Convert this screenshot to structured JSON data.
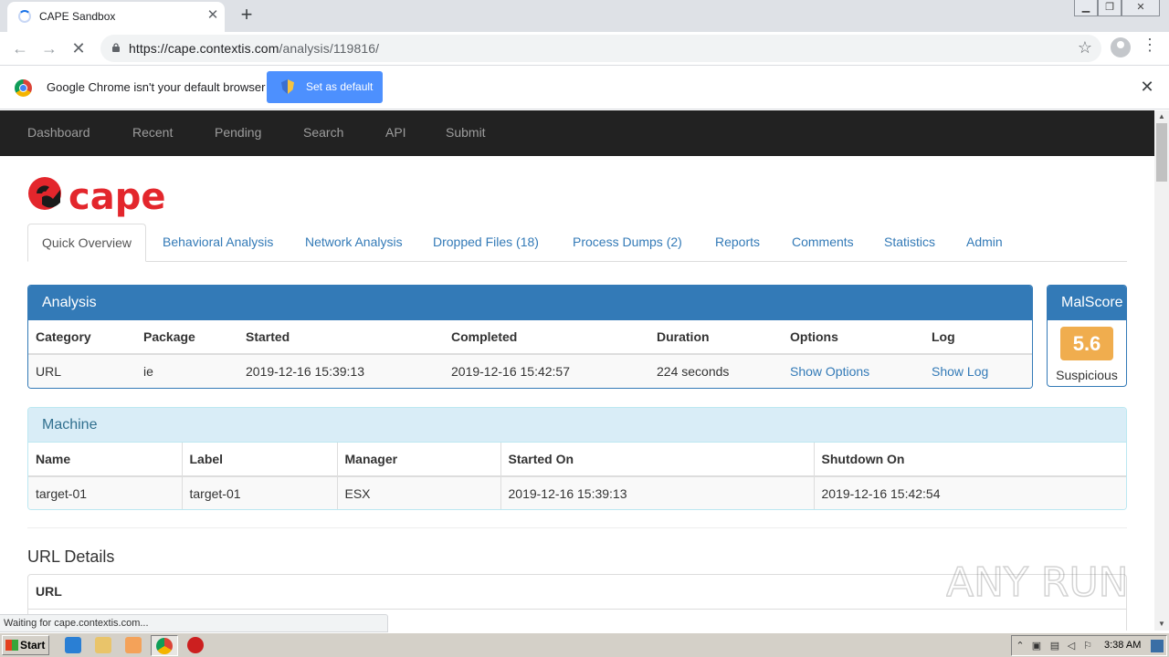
{
  "browser": {
    "tab_title": "CAPE Sandbox",
    "tab_close": "✕",
    "new_tab": "+",
    "url_host": "https://cape.contextis.com",
    "url_path": "/analysis/119816/",
    "infobar_text": "Google Chrome isn't your default browser",
    "infobar_button": "Set as default",
    "infobar_close": "✕",
    "status_text": "Waiting for cape.contextis.com..."
  },
  "navbar": {
    "items": [
      "Dashboard",
      "Recent",
      "Pending",
      "Search",
      "API",
      "Submit"
    ]
  },
  "logo_text": "cape",
  "tabs": {
    "quick_overview": "Quick Overview",
    "behavioral": "Behavioral Analysis",
    "network": "Network Analysis",
    "dropped": "Dropped Files (18)",
    "process_dumps": "Process Dumps (2)",
    "reports": "Reports",
    "comments": "Comments",
    "statistics": "Statistics",
    "admin": "Admin"
  },
  "analysis": {
    "title": "Analysis",
    "headers": {
      "category": "Category",
      "package": "Package",
      "started": "Started",
      "completed": "Completed",
      "duration": "Duration",
      "options": "Options",
      "log": "Log"
    },
    "row": {
      "category": "URL",
      "package": "ie",
      "started": "2019-12-16 15:39:13",
      "completed": "2019-12-16 15:42:57",
      "duration": "224 seconds",
      "options": "Show Options",
      "log": "Show Log"
    }
  },
  "malscore": {
    "title": "MalScore",
    "score": "5.6",
    "label": "Suspicious",
    "color": "#f0ad4e"
  },
  "machine": {
    "title": "Machine",
    "headers": {
      "name": "Name",
      "label": "Label",
      "manager": "Manager",
      "started_on": "Started On",
      "shutdown_on": "Shutdown On"
    },
    "row": {
      "name": "target-01",
      "label": "target-01",
      "manager": "ESX",
      "started_on": "2019-12-16 15:39:13",
      "shutdown_on": "2019-12-16 15:42:54"
    }
  },
  "url_details": {
    "title": "URL Details",
    "header": "URL"
  },
  "watermark": "ANY RUN",
  "taskbar": {
    "start": "Start",
    "clock": "3:38 AM"
  },
  "colors": {
    "primary": "#337ab7",
    "navbar": "#222222",
    "brand_red": "#e3262c"
  }
}
